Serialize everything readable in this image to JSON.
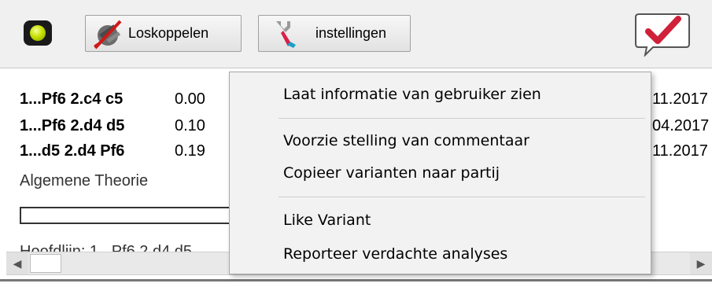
{
  "toolbar": {
    "disconnect_label": "Loskoppelen",
    "settings_label": "instellingen",
    "status_led_color": "#c8e000",
    "icons": [
      "status-led-icon",
      "disconnect-plug-icon",
      "wrench-icon",
      "checkmark-speech-icon"
    ]
  },
  "variants": [
    {
      "move": "1...Pf6 2.c4 c5",
      "value": "0.00",
      "date": "11.2017"
    },
    {
      "move": "1...Pf6 2.d4 d5",
      "value": "0.10",
      "date": "04.2017"
    },
    {
      "move": "1...d5 2.d4 Pf6",
      "value": "0.19",
      "date": "11.2017"
    }
  ],
  "theory_label": "Algemene Theorie",
  "cut_text": "Hoofdlijn: 1...Pf6 2.d4 d5",
  "context_menu": {
    "items": [
      "Laat informatie van gebruiker zien",
      "Voorzie stelling van commentaar",
      "Copieer varianten naar partij",
      "Like Variant",
      "Reporteer verdachte analyses"
    ]
  },
  "colors": {
    "toolbar_bg": "#f0f0f0",
    "menu_bg": "#f2f2f2",
    "check_red": "#d0203a"
  }
}
